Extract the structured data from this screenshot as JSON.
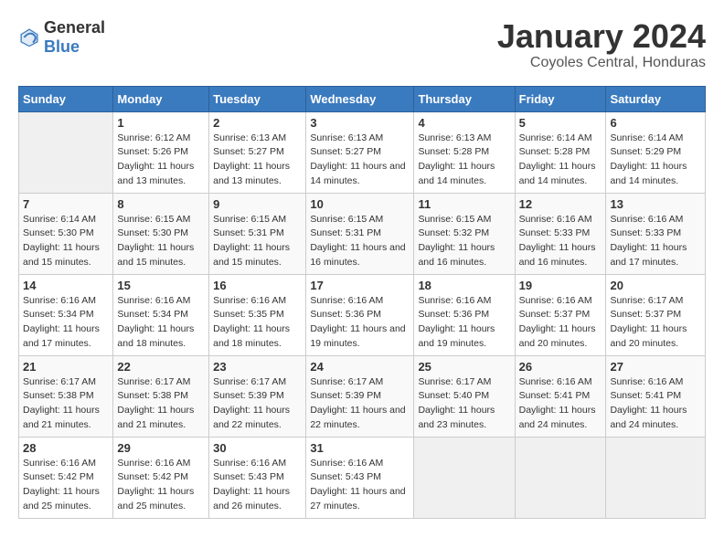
{
  "logo": {
    "general": "General",
    "blue": "Blue"
  },
  "header": {
    "title": "January 2024",
    "subtitle": "Coyoles Central, Honduras"
  },
  "calendar": {
    "weekdays": [
      "Sunday",
      "Monday",
      "Tuesday",
      "Wednesday",
      "Thursday",
      "Friday",
      "Saturday"
    ],
    "weeks": [
      [
        {
          "day": "",
          "sunrise": "",
          "sunset": "",
          "daylight": ""
        },
        {
          "day": "1",
          "sunrise": "6:12 AM",
          "sunset": "5:26 PM",
          "daylight": "11 hours and 13 minutes."
        },
        {
          "day": "2",
          "sunrise": "6:13 AM",
          "sunset": "5:27 PM",
          "daylight": "11 hours and 13 minutes."
        },
        {
          "day": "3",
          "sunrise": "6:13 AM",
          "sunset": "5:27 PM",
          "daylight": "11 hours and 14 minutes."
        },
        {
          "day": "4",
          "sunrise": "6:13 AM",
          "sunset": "5:28 PM",
          "daylight": "11 hours and 14 minutes."
        },
        {
          "day": "5",
          "sunrise": "6:14 AM",
          "sunset": "5:28 PM",
          "daylight": "11 hours and 14 minutes."
        },
        {
          "day": "6",
          "sunrise": "6:14 AM",
          "sunset": "5:29 PM",
          "daylight": "11 hours and 14 minutes."
        }
      ],
      [
        {
          "day": "7",
          "sunrise": "6:14 AM",
          "sunset": "5:30 PM",
          "daylight": "11 hours and 15 minutes."
        },
        {
          "day": "8",
          "sunrise": "6:15 AM",
          "sunset": "5:30 PM",
          "daylight": "11 hours and 15 minutes."
        },
        {
          "day": "9",
          "sunrise": "6:15 AM",
          "sunset": "5:31 PM",
          "daylight": "11 hours and 15 minutes."
        },
        {
          "day": "10",
          "sunrise": "6:15 AM",
          "sunset": "5:31 PM",
          "daylight": "11 hours and 16 minutes."
        },
        {
          "day": "11",
          "sunrise": "6:15 AM",
          "sunset": "5:32 PM",
          "daylight": "11 hours and 16 minutes."
        },
        {
          "day": "12",
          "sunrise": "6:16 AM",
          "sunset": "5:33 PM",
          "daylight": "11 hours and 16 minutes."
        },
        {
          "day": "13",
          "sunrise": "6:16 AM",
          "sunset": "5:33 PM",
          "daylight": "11 hours and 17 minutes."
        }
      ],
      [
        {
          "day": "14",
          "sunrise": "6:16 AM",
          "sunset": "5:34 PM",
          "daylight": "11 hours and 17 minutes."
        },
        {
          "day": "15",
          "sunrise": "6:16 AM",
          "sunset": "5:34 PM",
          "daylight": "11 hours and 18 minutes."
        },
        {
          "day": "16",
          "sunrise": "6:16 AM",
          "sunset": "5:35 PM",
          "daylight": "11 hours and 18 minutes."
        },
        {
          "day": "17",
          "sunrise": "6:16 AM",
          "sunset": "5:36 PM",
          "daylight": "11 hours and 19 minutes."
        },
        {
          "day": "18",
          "sunrise": "6:16 AM",
          "sunset": "5:36 PM",
          "daylight": "11 hours and 19 minutes."
        },
        {
          "day": "19",
          "sunrise": "6:16 AM",
          "sunset": "5:37 PM",
          "daylight": "11 hours and 20 minutes."
        },
        {
          "day": "20",
          "sunrise": "6:17 AM",
          "sunset": "5:37 PM",
          "daylight": "11 hours and 20 minutes."
        }
      ],
      [
        {
          "day": "21",
          "sunrise": "6:17 AM",
          "sunset": "5:38 PM",
          "daylight": "11 hours and 21 minutes."
        },
        {
          "day": "22",
          "sunrise": "6:17 AM",
          "sunset": "5:38 PM",
          "daylight": "11 hours and 21 minutes."
        },
        {
          "day": "23",
          "sunrise": "6:17 AM",
          "sunset": "5:39 PM",
          "daylight": "11 hours and 22 minutes."
        },
        {
          "day": "24",
          "sunrise": "6:17 AM",
          "sunset": "5:39 PM",
          "daylight": "11 hours and 22 minutes."
        },
        {
          "day": "25",
          "sunrise": "6:17 AM",
          "sunset": "5:40 PM",
          "daylight": "11 hours and 23 minutes."
        },
        {
          "day": "26",
          "sunrise": "6:16 AM",
          "sunset": "5:41 PM",
          "daylight": "11 hours and 24 minutes."
        },
        {
          "day": "27",
          "sunrise": "6:16 AM",
          "sunset": "5:41 PM",
          "daylight": "11 hours and 24 minutes."
        }
      ],
      [
        {
          "day": "28",
          "sunrise": "6:16 AM",
          "sunset": "5:42 PM",
          "daylight": "11 hours and 25 minutes."
        },
        {
          "day": "29",
          "sunrise": "6:16 AM",
          "sunset": "5:42 PM",
          "daylight": "11 hours and 25 minutes."
        },
        {
          "day": "30",
          "sunrise": "6:16 AM",
          "sunset": "5:43 PM",
          "daylight": "11 hours and 26 minutes."
        },
        {
          "day": "31",
          "sunrise": "6:16 AM",
          "sunset": "5:43 PM",
          "daylight": "11 hours and 27 minutes."
        },
        {
          "day": "",
          "sunrise": "",
          "sunset": "",
          "daylight": ""
        },
        {
          "day": "",
          "sunrise": "",
          "sunset": "",
          "daylight": ""
        },
        {
          "day": "",
          "sunrise": "",
          "sunset": "",
          "daylight": ""
        }
      ]
    ]
  }
}
